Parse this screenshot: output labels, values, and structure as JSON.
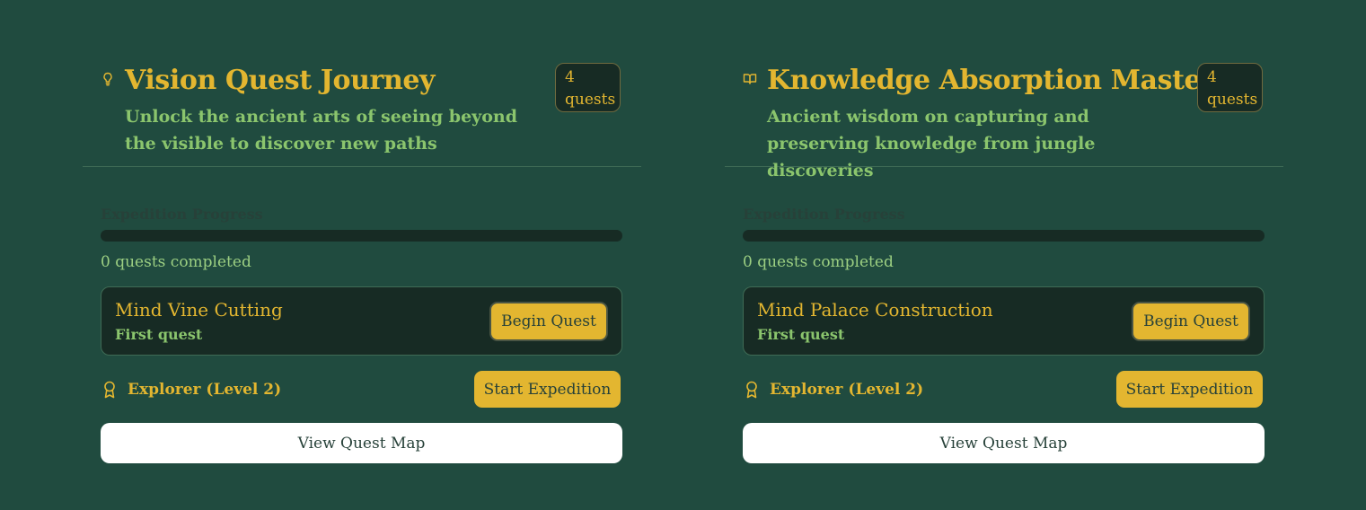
{
  "colors": {
    "background": "#204b3f",
    "accent": "#e3b630",
    "subtitle": "#8bc56d",
    "panel": "#172b24",
    "button_text": "#274139"
  },
  "cards": [
    {
      "icon": "lightbulb-icon",
      "title": "Vision Quest Journey",
      "subtitle": "Unlock the ancient arts of seeing beyond the visible to discover new paths",
      "quest_count_badge": "4 quests",
      "progress_label": "Expedition Progress",
      "progress": 0,
      "completed_text": "0 quests completed",
      "quest": {
        "name": "Mind Vine Cutting",
        "subtitle": "First quest",
        "button_label": "Begin Quest"
      },
      "rank_icon": "award-icon",
      "rank": "Explorer (Level 2)",
      "start_label": "Start Expedition",
      "map_label": "View Quest Map"
    },
    {
      "icon": "open-book-icon",
      "title": "Knowledge Absorption Mastery",
      "subtitle": "Ancient wisdom on capturing and preserving knowledge from jungle discoveries",
      "quest_count_badge": "4 quests",
      "progress_label": "Expedition Progress",
      "progress": 0,
      "completed_text": "0 quests completed",
      "quest": {
        "name": "Mind Palace Construction",
        "subtitle": "First quest",
        "button_label": "Begin Quest"
      },
      "rank_icon": "award-icon",
      "rank": "Explorer (Level 2)",
      "start_label": "Start Expedition",
      "map_label": "View Quest Map"
    }
  ]
}
